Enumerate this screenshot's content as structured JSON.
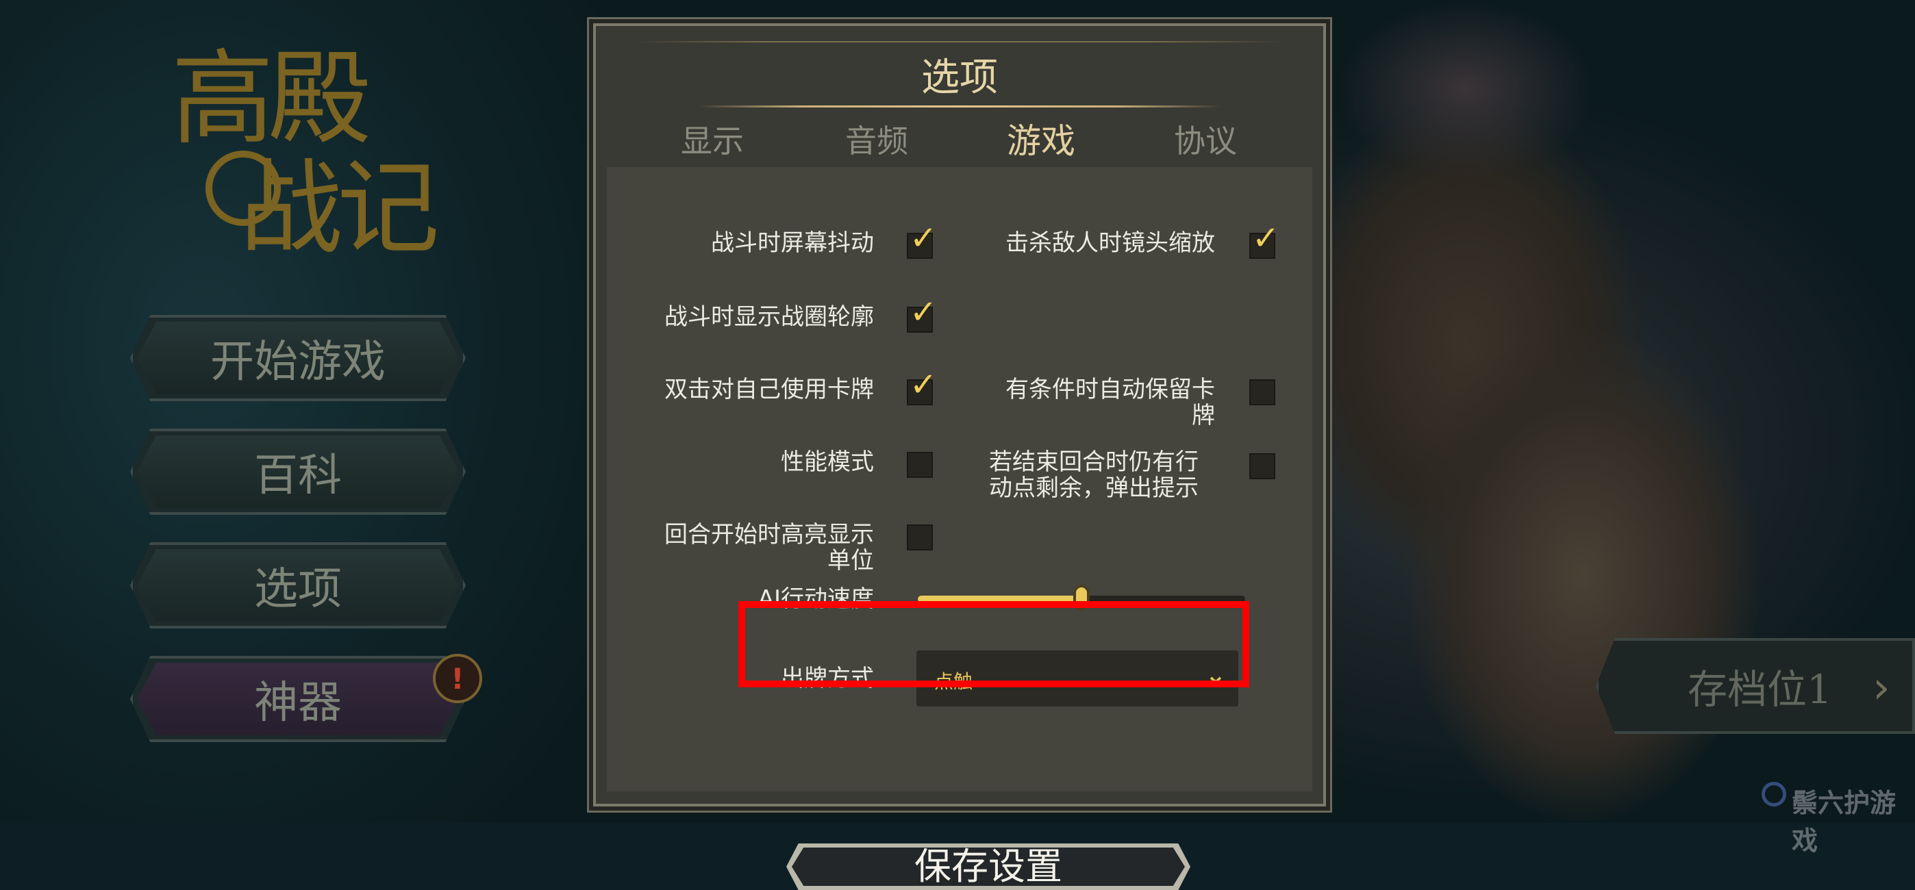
{
  "game": {
    "logo_line1": "高殿",
    "logo_line2": "战记"
  },
  "menu": {
    "start": "开始游戏",
    "encyclopedia": "百科",
    "options": "选项",
    "artifacts": "神器",
    "alert": "!"
  },
  "save_slot": {
    "label": "存档位1",
    "arrow": "›"
  },
  "dialog": {
    "title": "选项",
    "tabs": [
      "显示",
      "音频",
      "游戏",
      "协议"
    ],
    "active_tab": "游戏",
    "options": {
      "screen_shake": {
        "label": "战斗时屏幕抖动",
        "checked": true
      },
      "kill_zoom": {
        "label": "击杀敌人时镜头缩放",
        "checked": true
      },
      "battle_outline": {
        "label": "战斗时显示战圈轮廓",
        "checked": true
      },
      "double_click_self_line1": "双击对自己使用卡牌",
      "double_click_self_checked": true,
      "auto_keep_line1": "有条件时自动保留卡",
      "auto_keep_line2": "牌",
      "auto_keep_checked": false,
      "performance": {
        "label": "性能模式",
        "checked": false
      },
      "end_turn_line1": "若结束回合时仍有行",
      "end_turn_line2": "动点剩余，弹出提示",
      "end_turn_checked": false,
      "highlight_line1": "回合开始时高亮显示",
      "highlight_line2": "单位",
      "highlight_checked": false
    },
    "ai_speed": {
      "label": "AI行动速度",
      "value": 0.5
    },
    "play_mode": {
      "label": "出牌方式",
      "value": "点触",
      "chevron": "⌄"
    },
    "save_button": "保存设置"
  },
  "watermark": "鬃六护游戏",
  "colors": {
    "accent_gold": "#e9c95a",
    "highlight_red": "#ff0000",
    "panel_bg": "#45443d"
  }
}
